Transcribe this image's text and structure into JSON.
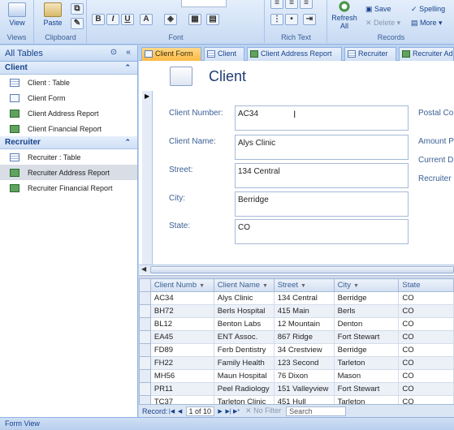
{
  "ribbon": {
    "views": {
      "view_label": "View",
      "group_label": "Views"
    },
    "clipboard": {
      "paste_label": "Paste",
      "group_label": "Clipboard"
    },
    "font": {
      "group_label": "Font",
      "bold": "B",
      "italic": "I",
      "underline": "U"
    },
    "rich_text": {
      "group_label": "Rich Text"
    },
    "records": {
      "refresh_label": "Refresh All",
      "save_label": "Save",
      "delete_label": "Delete",
      "spelling_label": "Spelling",
      "more_label": "More",
      "group_label": "Records"
    }
  },
  "nav": {
    "header": "All Tables",
    "groups": [
      {
        "name": "Client",
        "items": [
          {
            "label": "Client : Table",
            "icon": "table-icon"
          },
          {
            "label": "Client Form",
            "icon": "form-icon"
          },
          {
            "label": "Client Address Report",
            "icon": "report-icon"
          },
          {
            "label": "Client Financial Report",
            "icon": "report-icon"
          }
        ]
      },
      {
        "name": "Recruiter",
        "items": [
          {
            "label": "Recruiter : Table",
            "icon": "table-icon"
          },
          {
            "label": "Recruiter Address Report",
            "icon": "report-icon"
          },
          {
            "label": "Recruiter Financial Report",
            "icon": "report-icon"
          }
        ]
      }
    ]
  },
  "tabs": [
    "Client Form",
    "Client",
    "Client Address Report",
    "Recruiter",
    "Recruiter Ad"
  ],
  "form": {
    "title": "Client",
    "fields": [
      {
        "label": "Client Number:",
        "value": "AC34"
      },
      {
        "label": "Client Name:",
        "value": "Alys Clinic"
      },
      {
        "label": "Street:",
        "value": "134 Central"
      },
      {
        "label": "City:",
        "value": "Berridge"
      },
      {
        "label": "State:",
        "value": "CO"
      }
    ],
    "right_labels": [
      "Postal Co",
      "Amount P",
      "Current D",
      "Recruiter"
    ]
  },
  "grid": {
    "columns": [
      "Client Numb",
      "Client Name",
      "Street",
      "City",
      "State"
    ],
    "rows": [
      [
        "AC34",
        "Alys Clinic",
        "134 Central",
        "Berridge",
        "CO"
      ],
      [
        "BH72",
        "Berls Hospital",
        "415 Main",
        "Berls",
        "CO"
      ],
      [
        "BL12",
        "Benton Labs",
        "12 Mountain",
        "Denton",
        "CO"
      ],
      [
        "EA45",
        "ENT Assoc.",
        "867 Ridge",
        "Fort Stewart",
        "CO"
      ],
      [
        "FD89",
        "Ferb Dentistry",
        "34 Crestview",
        "Berridge",
        "CO"
      ],
      [
        "FH22",
        "Family Health",
        "123 Second",
        "Tarleton",
        "CO"
      ],
      [
        "MH56",
        "Maun Hospital",
        "76 Dixon",
        "Mason",
        "CO"
      ],
      [
        "PR11",
        "Peel Radiology",
        "151 Valleyview",
        "Fort Stewart",
        "CO"
      ],
      [
        "TC37",
        "Tarleton Clinic",
        "451 Hull",
        "Tarleton",
        "CO"
      ]
    ]
  },
  "recnav": {
    "label": "Record:",
    "position": "1 of 10",
    "filter": "No Filter",
    "search": "Search"
  },
  "status": "Form View"
}
